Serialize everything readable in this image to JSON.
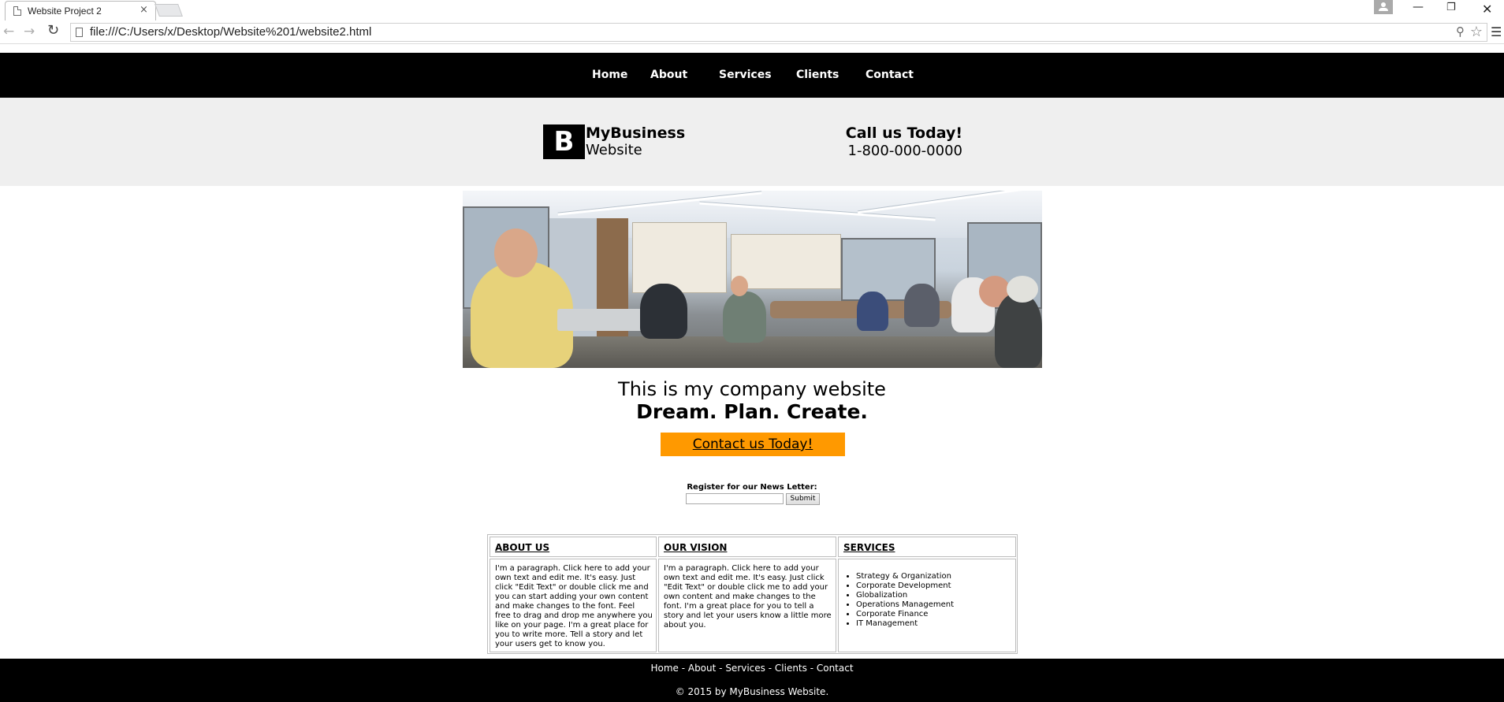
{
  "browser": {
    "tab_title": "Website Project 2",
    "tab_close": "×",
    "url": "file:///C:/Users/x/Desktop/Website%201/website2.html",
    "icons": {
      "back": "back-arrow-icon",
      "forward": "forward-arrow-icon",
      "reload": "reload-icon",
      "page": "page-icon",
      "zoom": "magnifier-icon",
      "bookmark": "star-icon",
      "menu": "hamburger-menu-icon",
      "profile": "profile-icon"
    },
    "window_controls": {
      "minimize": "—",
      "restore": "❐",
      "close": "✕"
    }
  },
  "site": {
    "nav": [
      "Home",
      "About",
      "Services",
      "Clients",
      "Contact"
    ],
    "logo_letter": "B",
    "brand_name": "MyBusiness",
    "brand_sub": "Website",
    "call_label": "Call us Today!",
    "call_number": "1-800-000-0000",
    "tagline": "This is my company website",
    "slogan": "Dream. Plan. Create.",
    "cta_label": "Contact us Today!",
    "newsletter": {
      "label": "Register for our News Letter:",
      "input_value": "",
      "submit_label": "Submit"
    },
    "columns": [
      {
        "heading": "ABOUT US",
        "body": "I'm a paragraph. Click here to add your own text and edit me. It's easy. Just click \"Edit Text\" or double click me and you can start adding your own content and make changes to the font. Feel free to drag and drop me anywhere you like on your page. I'm a great place for you to write more. Tell a story and let your users get to know you."
      },
      {
        "heading": "OUR VISION",
        "body": "I'm a paragraph. Click here to add your own text and edit me. It's easy. Just click \"Edit Text\" or double click me to add your own content and make changes to the font. I'm a great place for you to tell a story and let your users know a little more about you."
      },
      {
        "heading": "SERVICES",
        "items": [
          "Strategy & Organization",
          "Corporate Development",
          "Globalization",
          "Operations Management",
          "Corporate Finance",
          "IT Management"
        ]
      }
    ],
    "footer_nav": [
      "Home",
      "About",
      "Services",
      "Clients",
      "Contact"
    ],
    "footer_separator": " - ",
    "copyright": "© 2015 by MyBusiness Website.",
    "colors": {
      "nav_bg": "#000000",
      "header_bg": "#efefef",
      "cta_bg": "#ff9900",
      "footer_bg": "#000000"
    }
  }
}
